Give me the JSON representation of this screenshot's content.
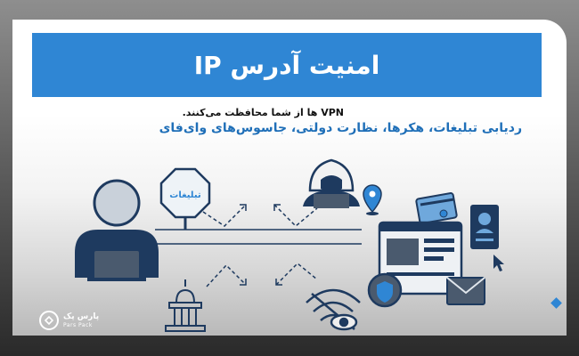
{
  "banner": {
    "title": "امنیت آدرس IP"
  },
  "subtitle": {
    "line1": "VPN ها از شما محافظت می‌کنند.",
    "line2": "ردیابی تبلیغات، هکرها، نظارت دولتی، جاسوس‌های وای‌فای"
  },
  "illustration": {
    "ads_sign_label": "تبلیغات"
  },
  "logo": {
    "name_fa": "پارس پک",
    "name_en": "Pars Pack"
  },
  "colors": {
    "brand_blue": "#2f86d4",
    "dark_navy": "#1e3a5f",
    "subtitle_blue": "#1f6fb8"
  },
  "icons": [
    "user-icon",
    "stop-sign-icon",
    "hacker-icon",
    "government-building-icon",
    "wifi-eye-icon",
    "location-pin-icon",
    "credit-card-icon",
    "browser-window-icon",
    "id-card-icon",
    "envelope-icon",
    "cursor-icon",
    "shield-icon"
  ]
}
